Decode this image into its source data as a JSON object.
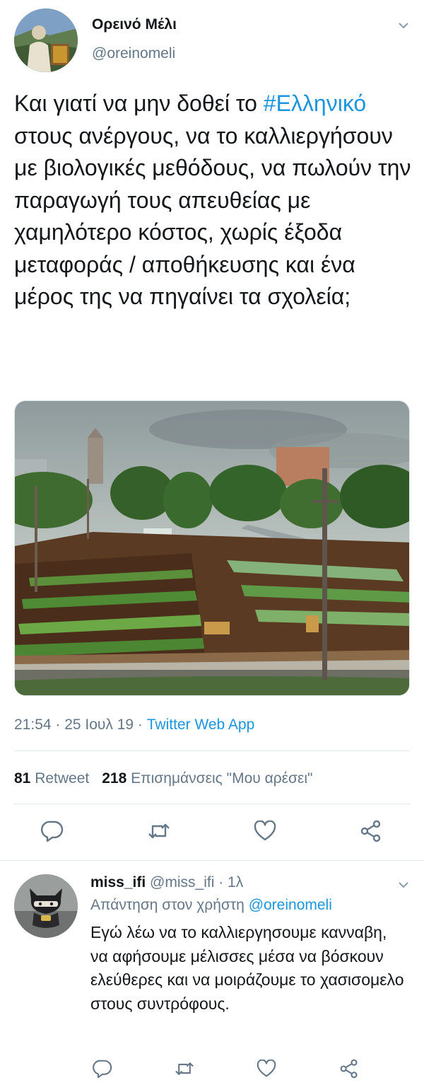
{
  "tweet": {
    "author_name": "Ορεινό Μέλι",
    "author_handle": "@oreinomeli",
    "text_before": "Και γιατί να μην δοθεί το ",
    "hashtag": "#Ελληνικό",
    "text_after": " στους ανέργους, να το καλλιεργήσουν με βιολογικές μεθόδους, να πωλούν την παραγωγή τους απευθείας με χαμηλότερο κόστος, χωρίς έξοδα μεταφοράς / αποθήκευσης και ένα μέρος της να πηγαίνει τα σχολεία;",
    "time_date": "21:54 · 25 Ιουλ 19 · ",
    "app": "Twitter Web App",
    "retweets_count": "81",
    "retweets_label": "Retweet",
    "likes_count": "218",
    "likes_label": "Επισημάνσεις \"Μου αρέσει\""
  },
  "reply": {
    "author_name": "miss_ifi",
    "author_handle_time": " @miss_ifi · 1λ",
    "replying_label": "Απάντηση στον χρήστη ",
    "replying_to": "@oreinomeli",
    "text": "Εγώ λέω να το καλλιεργησουμε κανναβη, να αφήσουμε μέλισσες μέσα να βόσκουν ελεύθερες και να μοιράζουμε το χασισομελο στους συντρόφους."
  },
  "icons": [
    "chevron-down-icon",
    "reply-icon",
    "retweet-icon",
    "like-icon",
    "share-icon"
  ],
  "colors": {
    "link": "#1b95e0",
    "secondary": "#657786",
    "text": "#14171a",
    "divider": "#e1e8ed"
  }
}
